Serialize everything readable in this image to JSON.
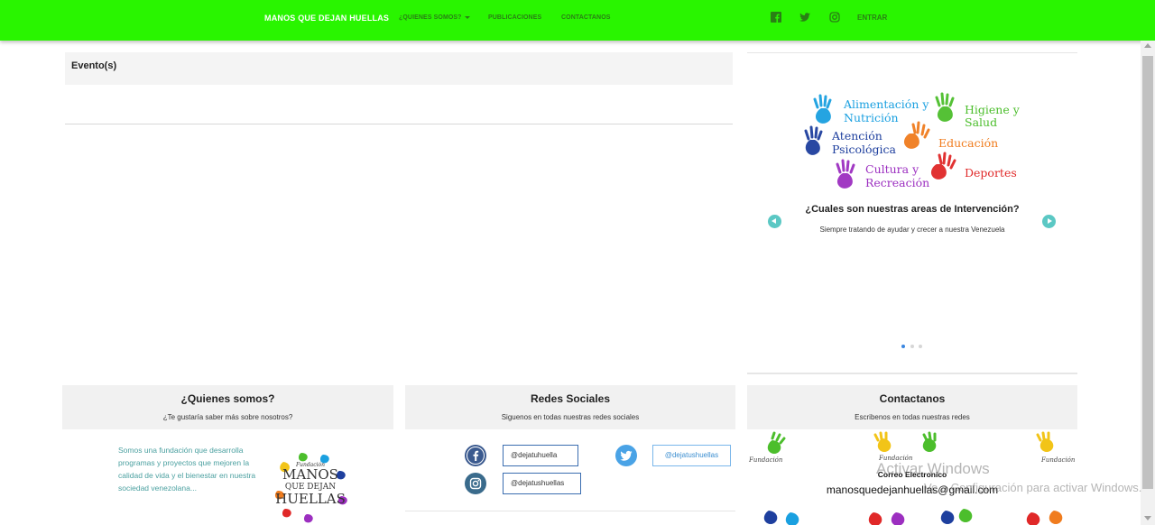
{
  "navbar": {
    "brand": "MANOS QUE DEJAN HUELLAS",
    "links": [
      {
        "label": "¿QUIENES SOMOS?",
        "dropdown": true
      },
      {
        "label": "PUBLICACIONES"
      },
      {
        "label": "CONTACTANOS"
      }
    ],
    "social_icons": [
      "facebook-icon",
      "twitter-icon",
      "instagram-icon"
    ],
    "login_label": "ENTRAR",
    "bg_color": "#29f500"
  },
  "events": {
    "title": "Evento(s)"
  },
  "carousel": {
    "areas": [
      {
        "label_line1": "Alimentación y",
        "label_line2": "Nutrición",
        "color": "#1aa0e0"
      },
      {
        "label_line1": "Higiene y",
        "label_line2": "Salud",
        "color": "#4cbe2c"
      },
      {
        "label_line1": "Atención",
        "label_line2": "Psicológica",
        "color": "#1e3f9e"
      },
      {
        "label_line1": "Educación",
        "label_line2": "",
        "color": "#f07c1e"
      },
      {
        "label_line1": "Cultura y",
        "label_line2": "Recreación",
        "color": "#9c2fc0"
      },
      {
        "label_line1": "Deportes",
        "label_line2": "",
        "color": "#e02828"
      }
    ],
    "caption_title": "¿Cuales son nuestras areas de Intervención?",
    "caption_subtitle": "Siempre tratando de ayudar y crecer a nuestra Venezuela",
    "active_slide": 1,
    "slide_count": 3
  },
  "footer": {
    "about": {
      "title": "¿Quienes somos?",
      "subtitle": "¿Te gustaría saber más sobre nosotros?",
      "text": "Somos una fundación que desarrolla programas y proyectos que mejoren la calidad de vida y el bienestar en nuestra sociedad venezolana...",
      "logo_top": "Fundación",
      "logo_line1": "MANOS",
      "logo_line2": "QUE DEJAN",
      "logo_line3": "HUELLAS"
    },
    "social": {
      "title": "Redes Sociales",
      "subtitle": "Siguenos en todas nuestras redes sociales",
      "facebook": "@dejatuhuella",
      "twitter": "@dejatushuellas",
      "instagram": "@dejatushuellas"
    },
    "contact": {
      "title": "Contactanos",
      "subtitle": "Escribenos en todas nuestras redes",
      "email_label": "Correo Electronico",
      "email": "manosquedejanhuellas@gmail.com",
      "strip_text": "Fundación"
    }
  },
  "overlay": {
    "watermark_line1": "Activar Windows",
    "watermark_line2": "Ve a Configuración para activar Windows."
  }
}
